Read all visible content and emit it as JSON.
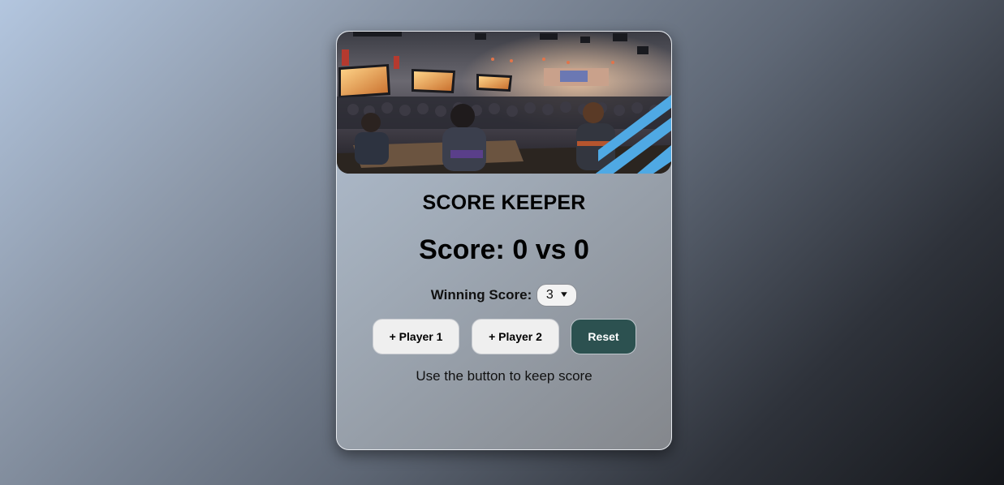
{
  "card": {
    "hero_image": "esports-arena-illustration"
  },
  "title": "SCORE KEEPER",
  "score": {
    "prefix": "Score:",
    "player1": "0",
    "separator": "vs",
    "player2": "0"
  },
  "winning_score": {
    "label": "Winning Score:",
    "selected": "3"
  },
  "buttons": {
    "player1": "+ Player 1",
    "player2": "+ Player 2",
    "reset": "Reset"
  },
  "status_text": "Use the button to keep score",
  "colors": {
    "reset_button": "#2c5150",
    "player_button": "#efefef",
    "accent_stripes": "#4fa9e4"
  }
}
